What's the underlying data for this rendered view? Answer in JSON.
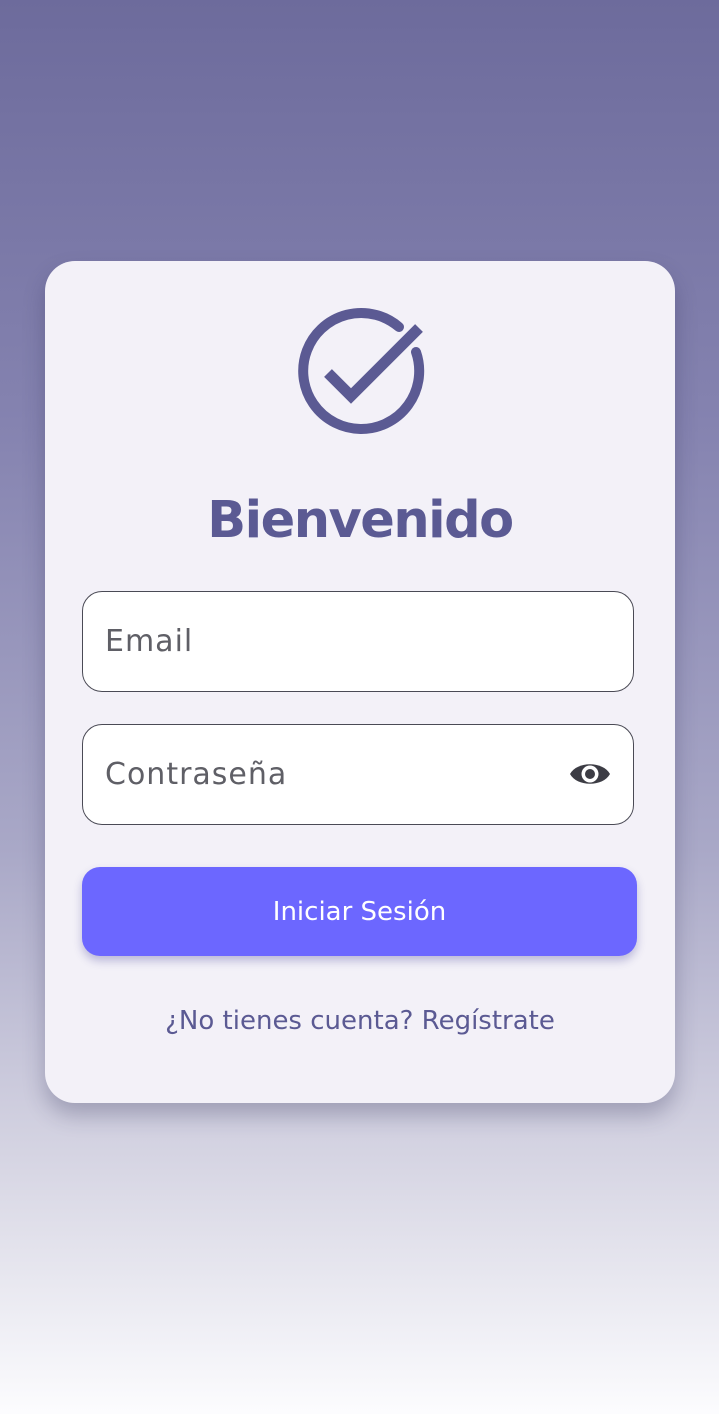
{
  "login": {
    "title": "Bienvenido",
    "email_placeholder": "Email",
    "password_placeholder": "Contraseña",
    "submit_label": "Iniciar Sesión",
    "register_prompt": "¿No tienes cuenta? Regístrate"
  },
  "icons": {
    "logo": "check-circle-icon",
    "password_toggle": "eye-icon"
  },
  "colors": {
    "brand": "#5b5a93",
    "button": "#6c67ff",
    "card_background": "#f3f1f8"
  }
}
